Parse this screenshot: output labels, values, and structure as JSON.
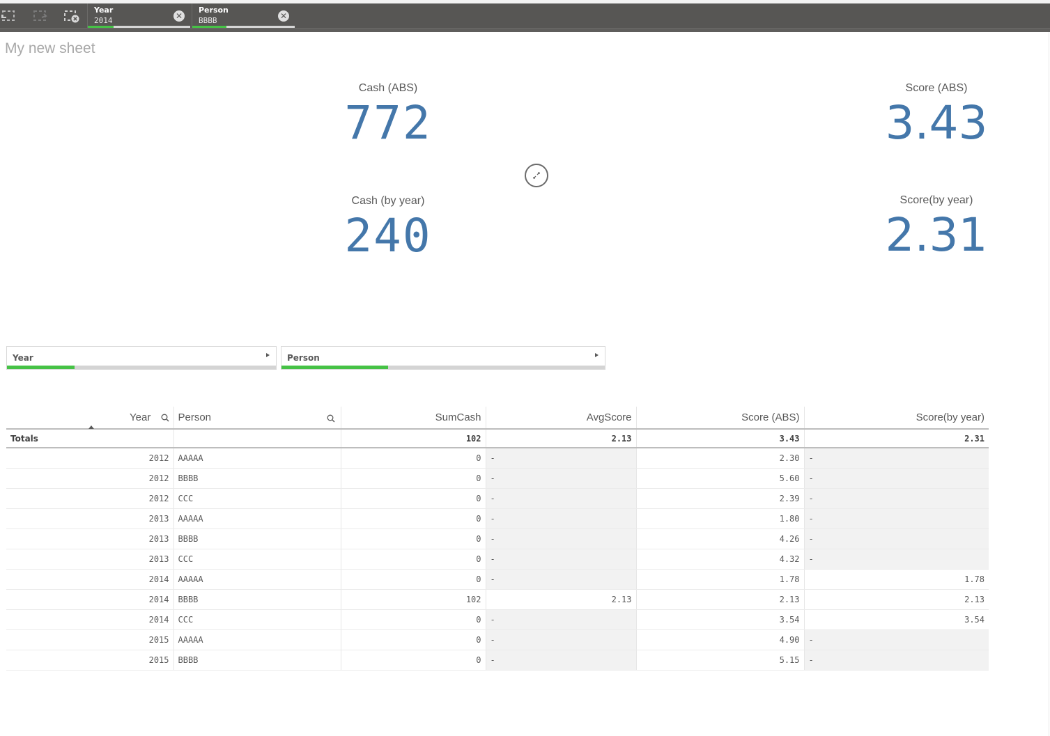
{
  "selections_bar": {
    "tools": [
      {
        "name": "step-back-icon"
      },
      {
        "name": "step-forward-icon"
      },
      {
        "name": "clear-all-selections-icon"
      }
    ],
    "chips": [
      {
        "label": "Year",
        "value": "2014",
        "selected_fraction": 0.25
      },
      {
        "label": "Person",
        "value": "BBBB",
        "selected_fraction": 0.33
      }
    ]
  },
  "sheet": {
    "title": "My new sheet"
  },
  "kpis": [
    {
      "title": "Cash (ABS)",
      "value": "772"
    },
    {
      "title": "Score (ABS)",
      "value": "3.43"
    },
    {
      "title": "Cash (by year)",
      "value": "240"
    },
    {
      "title": "Score(by year)",
      "value": "2.31"
    }
  ],
  "filters": [
    {
      "label": "Year",
      "selected_fraction": 0.25
    },
    {
      "label": "Person",
      "selected_fraction": 0.33
    }
  ],
  "table": {
    "columns": [
      "Year",
      "Person",
      "SumCash",
      "AvgScore",
      "Score (ABS)",
      "Score(by year)"
    ],
    "totals": {
      "label": "Totals",
      "person": "",
      "sumcash": "102",
      "avgscore": "2.13",
      "score_abs": "3.43",
      "score_by_year": "2.31"
    },
    "rows": [
      {
        "year": "2012",
        "person": "AAAAA",
        "sumcash": "0",
        "avgscore": "-",
        "score_abs": "2.30",
        "score_by_year": "-"
      },
      {
        "year": "2012",
        "person": "BBBB",
        "sumcash": "0",
        "avgscore": "-",
        "score_abs": "5.60",
        "score_by_year": "-"
      },
      {
        "year": "2012",
        "person": "CCC",
        "sumcash": "0",
        "avgscore": "-",
        "score_abs": "2.39",
        "score_by_year": "-"
      },
      {
        "year": "2013",
        "person": "AAAAA",
        "sumcash": "0",
        "avgscore": "-",
        "score_abs": "1.80",
        "score_by_year": "-"
      },
      {
        "year": "2013",
        "person": "BBBB",
        "sumcash": "0",
        "avgscore": "-",
        "score_abs": "4.26",
        "score_by_year": "-"
      },
      {
        "year": "2013",
        "person": "CCC",
        "sumcash": "0",
        "avgscore": "-",
        "score_abs": "4.32",
        "score_by_year": "-"
      },
      {
        "year": "2014",
        "person": "AAAAA",
        "sumcash": "0",
        "avgscore": "-",
        "score_abs": "1.78",
        "score_by_year": "1.78"
      },
      {
        "year": "2014",
        "person": "BBBB",
        "sumcash": "102",
        "avgscore": "2.13",
        "score_abs": "2.13",
        "score_by_year": "2.13"
      },
      {
        "year": "2014",
        "person": "CCC",
        "sumcash": "0",
        "avgscore": "-",
        "score_abs": "3.54",
        "score_by_year": "3.54"
      },
      {
        "year": "2015",
        "person": "AAAAA",
        "sumcash": "0",
        "avgscore": "-",
        "score_abs": "4.90",
        "score_by_year": "-"
      },
      {
        "year": "2015",
        "person": "BBBB",
        "sumcash": "0",
        "avgscore": "-",
        "score_abs": "5.15",
        "score_by_year": "-"
      }
    ]
  },
  "colors": {
    "kpi_value": "#4477aa",
    "selected_green": "#46c246",
    "toolbar_bg": "#575654",
    "null_cell_bg": "#f2f2f2"
  }
}
